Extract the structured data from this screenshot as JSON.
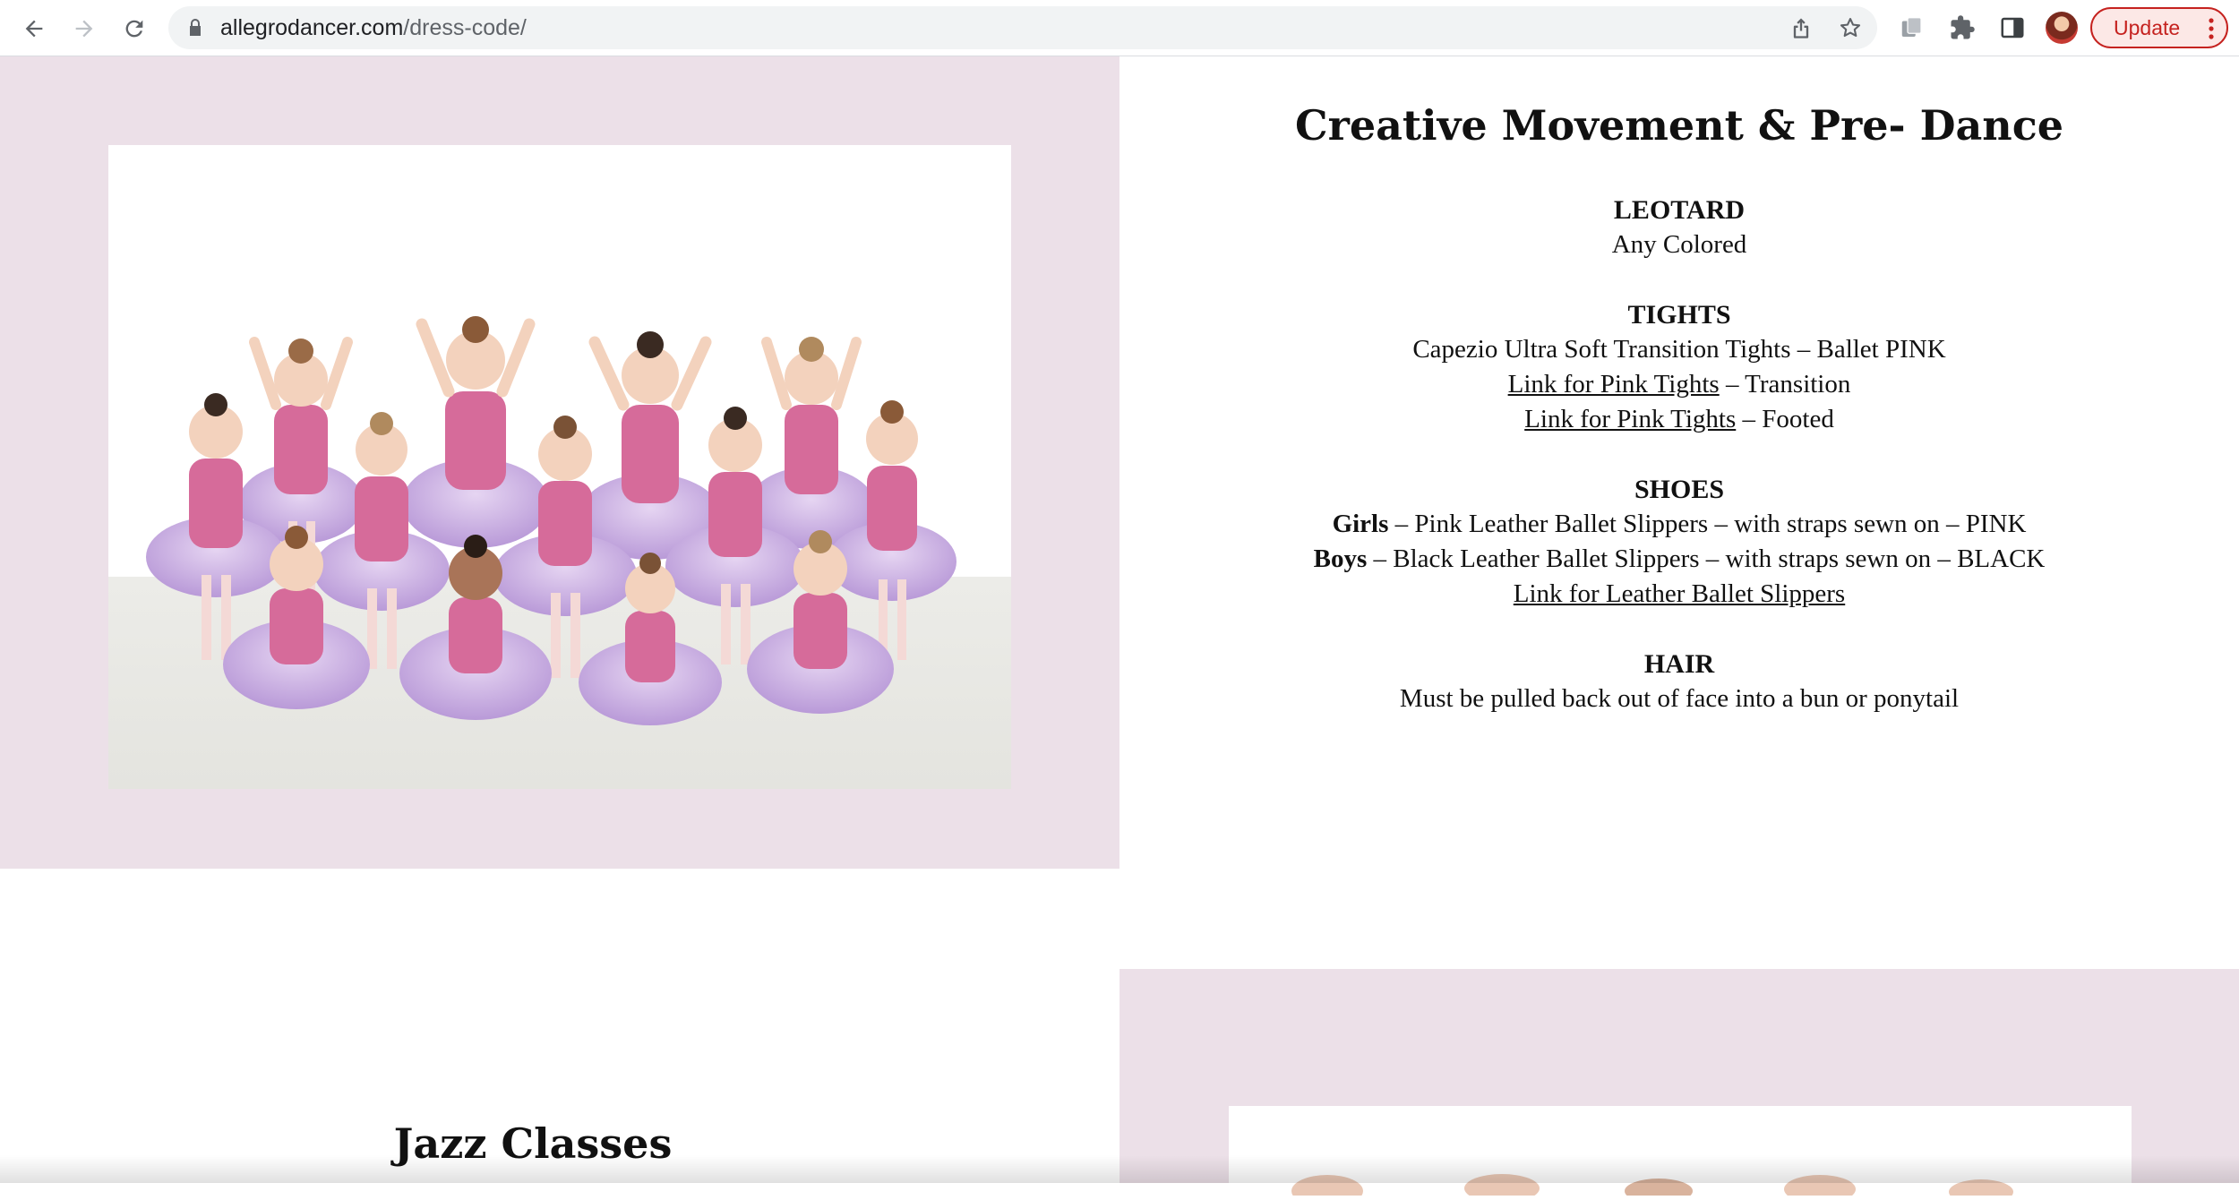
{
  "browser": {
    "url_domain": "allegrodancer.com",
    "url_path": "/dress-code/",
    "update_label": "Update",
    "icons": [
      "back-arrow-icon",
      "forward-arrow-icon",
      "reload-icon",
      "lock-icon",
      "share-icon",
      "star-icon",
      "tab-search-icon",
      "extensions-icon",
      "side-panel-icon",
      "profile-avatar",
      "menu-dots-icon"
    ]
  },
  "dress_code": {
    "title": "Creative Movement & Pre- Dance",
    "leotard": {
      "heading": "LEOTARD",
      "text": "Any Colored"
    },
    "tights": {
      "heading": "TIGHTS",
      "line1": "Capezio Ultra Soft Transition Tights – Ballet PINK",
      "link1": "Link for Pink Tights",
      "link1_suffix": " – Transition",
      "link2": "Link for Pink Tights",
      "link2_suffix": " – Footed"
    },
    "shoes": {
      "heading": "SHOES",
      "girls_label": "Girls",
      "girls_text": " – Pink Leather Ballet Slippers – with straps sewn on – PINK",
      "boys_label": "Boys",
      "boys_text": " – Black Leather Ballet Slippers – with straps sewn on – BLACK",
      "link": "Link for Leather Ballet Slippers"
    },
    "hair": {
      "heading": "HAIR",
      "text": "Must be pulled back out of face into a bun or ponytail"
    }
  },
  "next_section": {
    "title": "Jazz Classes"
  },
  "colors": {
    "panel_bg": "#ece0e8",
    "update_red": "#c5221f",
    "omnibox_bg": "#f1f3f4"
  }
}
